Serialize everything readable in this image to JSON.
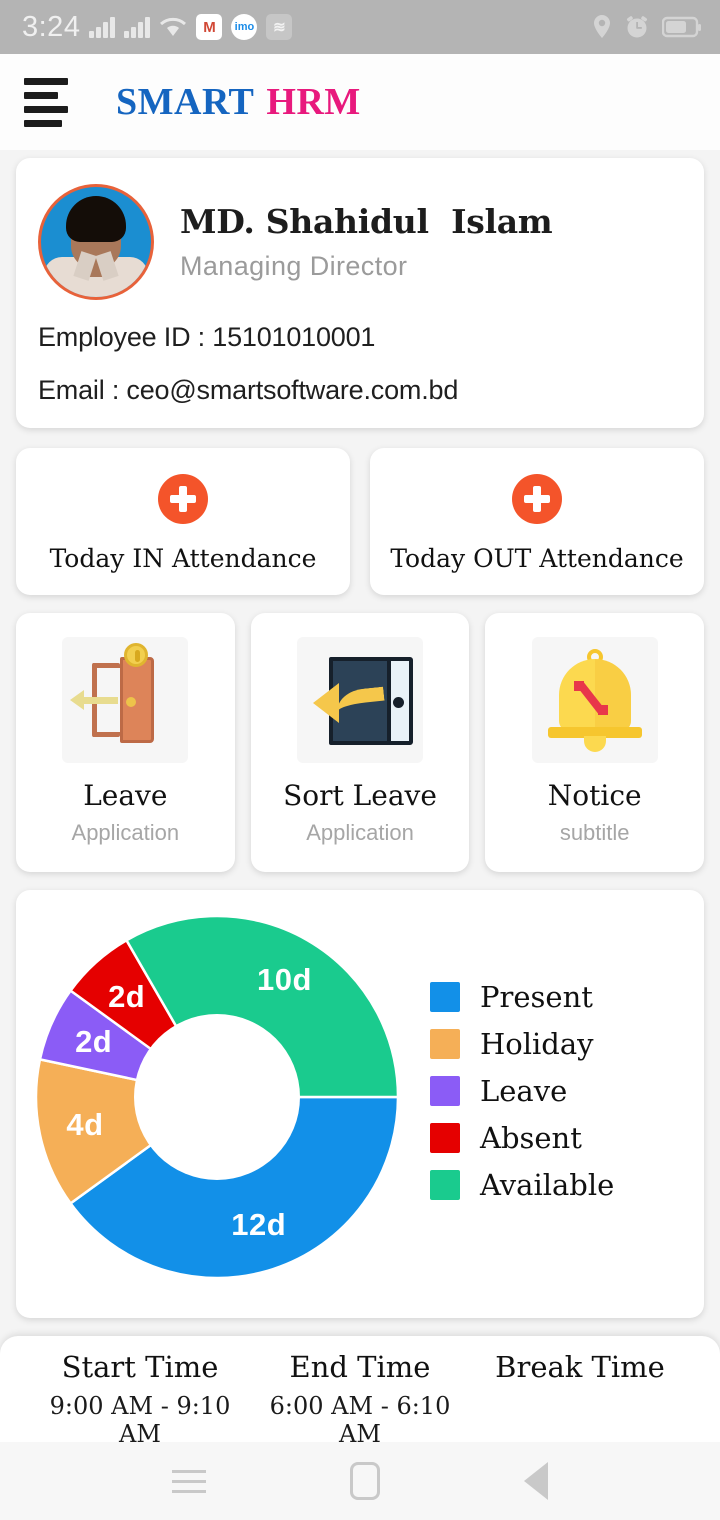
{
  "statusbar": {
    "time": "3:24",
    "icons": [
      "signal-bars-icon",
      "signal-bars-icon",
      "wifi-icon",
      "gmail-icon",
      "imo-icon",
      "stack-icon"
    ],
    "gmail_glyph": "M",
    "imo_glyph": "imo",
    "stack_glyph": "≋",
    "right_icons": [
      "location-pin-icon",
      "alarm-clock-icon",
      "battery-icon"
    ]
  },
  "appbar": {
    "menu_icon": "hamburger-menu-icon",
    "brand_first": "SMART",
    "brand_second": "HRM",
    "brand_first_color": "#1565c0",
    "brand_second_color": "#e8197d"
  },
  "profile": {
    "name": "MD. Shahidul  Islam",
    "role": "Managing Director",
    "employee_id_line": "Employee ID : 15101010001",
    "email_line": "Email : ceo@smartsoftware.com.bd"
  },
  "attendance": [
    {
      "label": "Today IN Attendance",
      "icon": "plus-circle-icon",
      "color": "#f4542a"
    },
    {
      "label": "Today OUT Attendance",
      "icon": "plus-circle-icon",
      "color": "#f4542a"
    }
  ],
  "tiles": [
    {
      "title": "Leave",
      "subtitle": "Application",
      "icon": "door-exit-icon"
    },
    {
      "title": "Sort Leave",
      "subtitle": "Application",
      "icon": "door-arrow-icon"
    },
    {
      "title": "Notice",
      "subtitle": "subtitle",
      "icon": "bell-percent-icon"
    }
  ],
  "chart_data": {
    "type": "pie",
    "title": "",
    "categories": [
      "Present",
      "Holiday",
      "Leave",
      "Absent",
      "Available"
    ],
    "values": [
      12,
      4,
      2,
      2,
      10
    ],
    "value_labels": [
      "12d",
      "4d",
      "2d",
      "2d",
      "10d"
    ],
    "colors": [
      "#1290e8",
      "#f5af57",
      "#8b5cf6",
      "#e50000",
      "#1acb8e"
    ],
    "unit": "d",
    "total": 30,
    "donut": true,
    "start_angle_deg": 0,
    "direction": "clockwise",
    "legend_position": "right",
    "legend": [
      "Present",
      "Holiday",
      "Leave",
      "Absent",
      "Available"
    ]
  },
  "times": [
    {
      "title": "Start Time",
      "value": "9:00 AM - 9:10 AM"
    },
    {
      "title": "End Time",
      "value": "6:00 AM - 6:10 AM"
    },
    {
      "title": "Break Time",
      "value": ""
    }
  ],
  "navbar": {
    "recents": "recents-icon",
    "home": "home-icon",
    "back": "back-icon"
  }
}
